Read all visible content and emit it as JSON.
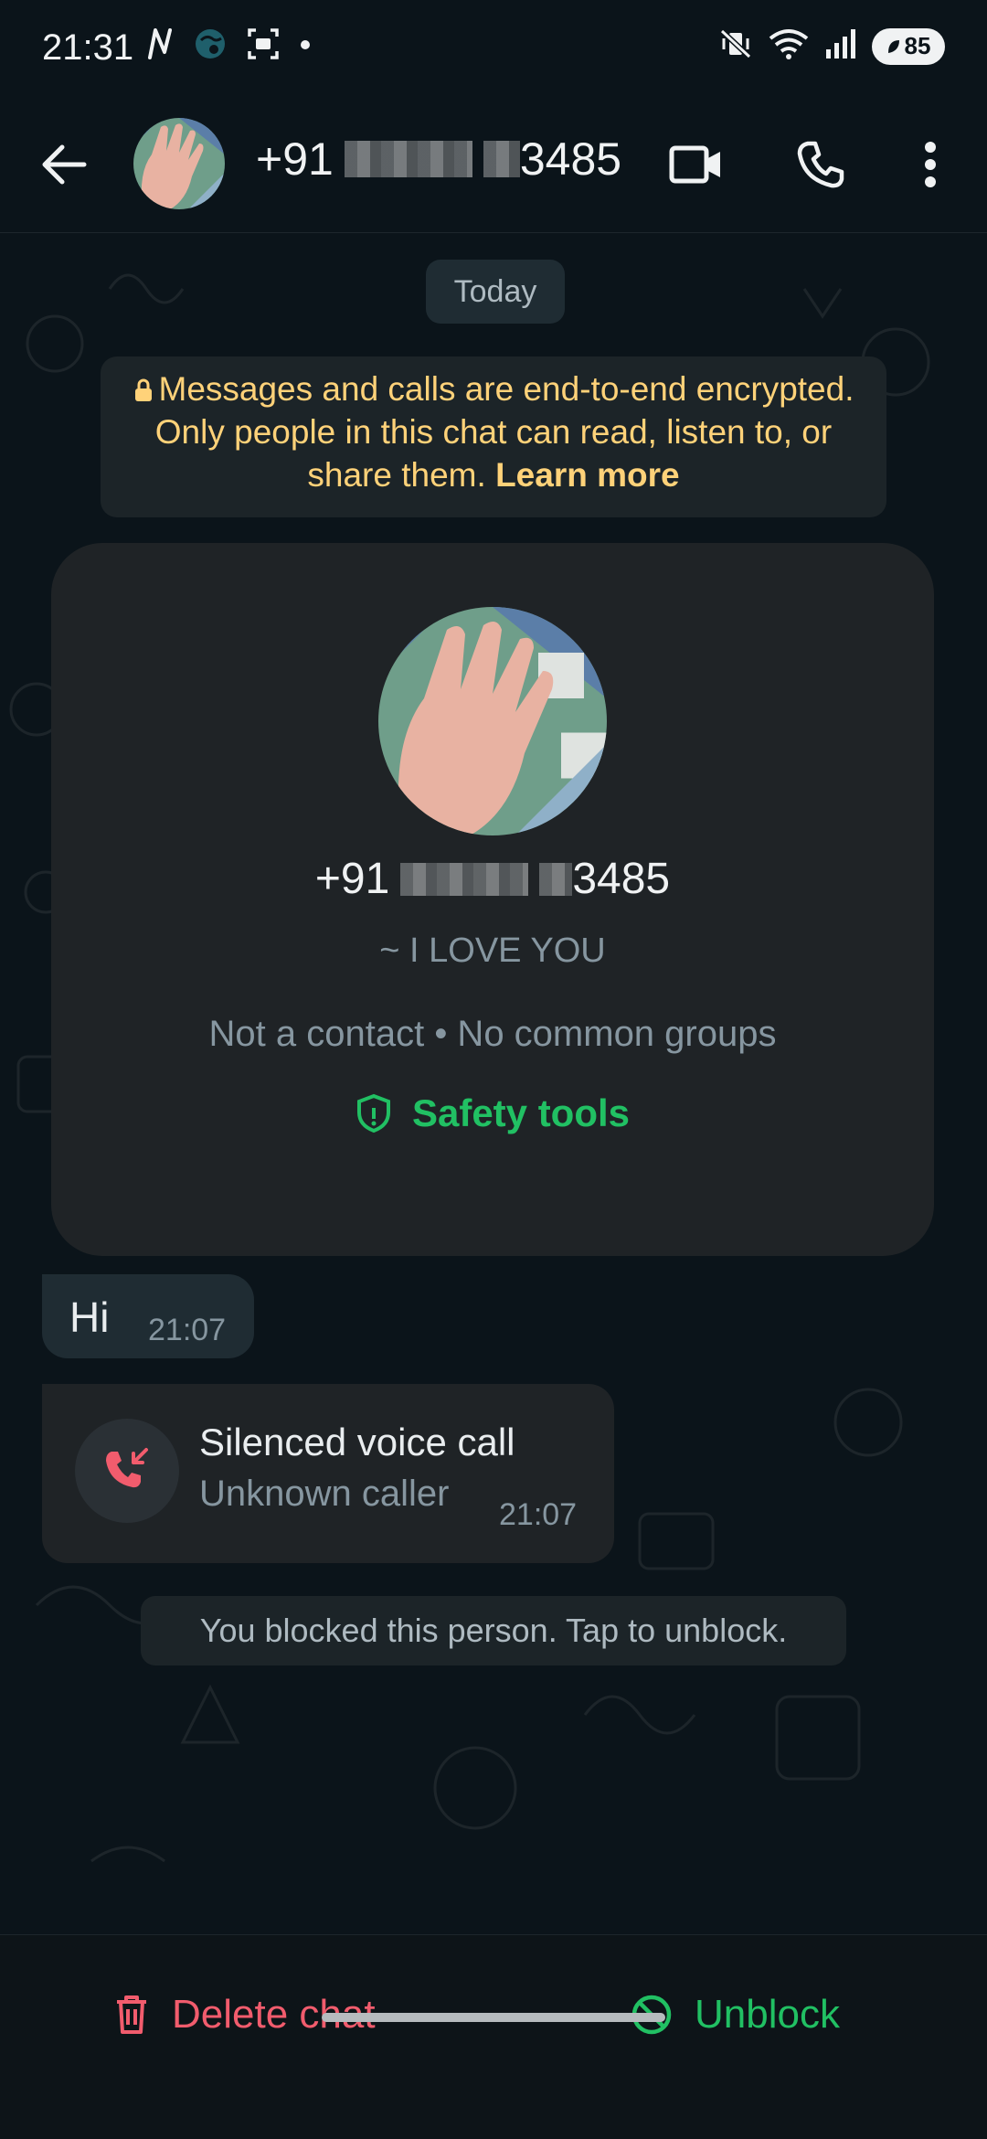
{
  "status_bar": {
    "time": "21:31",
    "left_icons": [
      "n-icon",
      "world-icon",
      "screenshot-icon",
      "dot-icon"
    ],
    "right_icons": [
      "vibrate-mute-icon",
      "wifi-icon",
      "signal-icon"
    ],
    "battery": "85"
  },
  "header": {
    "title_prefix": "+91",
    "title_suffix": "3485",
    "icons": [
      "back-arrow-icon",
      "video-call-icon",
      "voice-call-icon",
      "more-options-icon"
    ]
  },
  "chat": {
    "date_chip": "Today",
    "encryption_note": "Messages and calls are end-to-end encrypted. Only people in this chat can read, listen to, or share them.",
    "learn_more": "Learn more",
    "card": {
      "number_prefix": "+91",
      "number_suffix": "3485",
      "about": "~ I LOVE YOU",
      "meta": "Not a contact • No common groups",
      "safety_tools": "Safety tools"
    },
    "messages": [
      {
        "text": "Hi",
        "time": "21:07"
      }
    ],
    "call": {
      "title": "Silenced voice call",
      "subtitle": "Unknown caller",
      "time": "21:07"
    },
    "blocked_notice": "You blocked this person. Tap to unblock."
  },
  "bottom": {
    "delete_label": "Delete chat",
    "unblock_label": "Unblock"
  },
  "colors": {
    "background": "#0b141a",
    "accent_green": "#21c063",
    "danger_red": "#f15c6d",
    "notice_yellow": "#ffd279"
  }
}
